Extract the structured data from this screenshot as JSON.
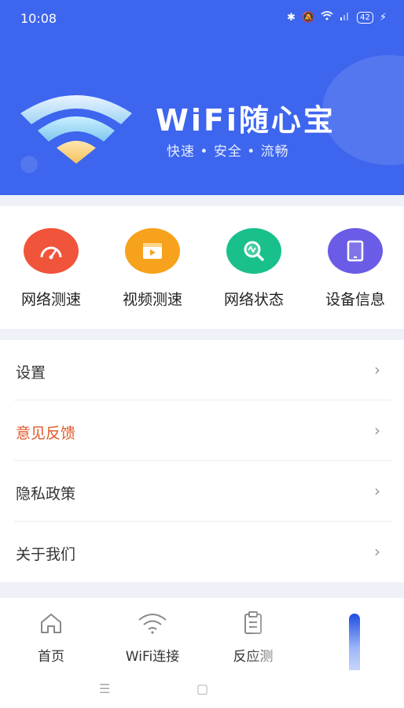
{
  "status_bar": {
    "time": "10:08",
    "icons": [
      "bluetooth-icon",
      "mute-icon",
      "wifi-icon",
      "signal-icon"
    ],
    "battery": "42"
  },
  "header": {
    "title": "WiFi随心宝",
    "tagline": "快速 • 安全 • 流畅",
    "background": "#3d65ee"
  },
  "tools": [
    {
      "label": "网络测速",
      "icon": "speedometer-icon",
      "color": "#f0543a"
    },
    {
      "label": "视频测速",
      "icon": "video-icon",
      "color": "#f7a21c"
    },
    {
      "label": "网络状态",
      "icon": "network-search-icon",
      "color": "#19c08c"
    },
    {
      "label": "设备信息",
      "icon": "tablet-icon",
      "color": "#6a5ce6"
    }
  ],
  "menu": [
    {
      "label": "设置"
    },
    {
      "label": "意见反馈",
      "accent": "#e05a2b"
    },
    {
      "label": "隐私政策"
    },
    {
      "label": "关于我们"
    }
  ],
  "tabbar": [
    {
      "label": "首页",
      "icon": "home-icon"
    },
    {
      "label": "WiFi连接",
      "icon": "wifi-icon"
    },
    {
      "label": "反应测",
      "icon": "clipboard-icon"
    }
  ],
  "system_nav": [
    "menu-icon",
    "home-square-icon"
  ]
}
